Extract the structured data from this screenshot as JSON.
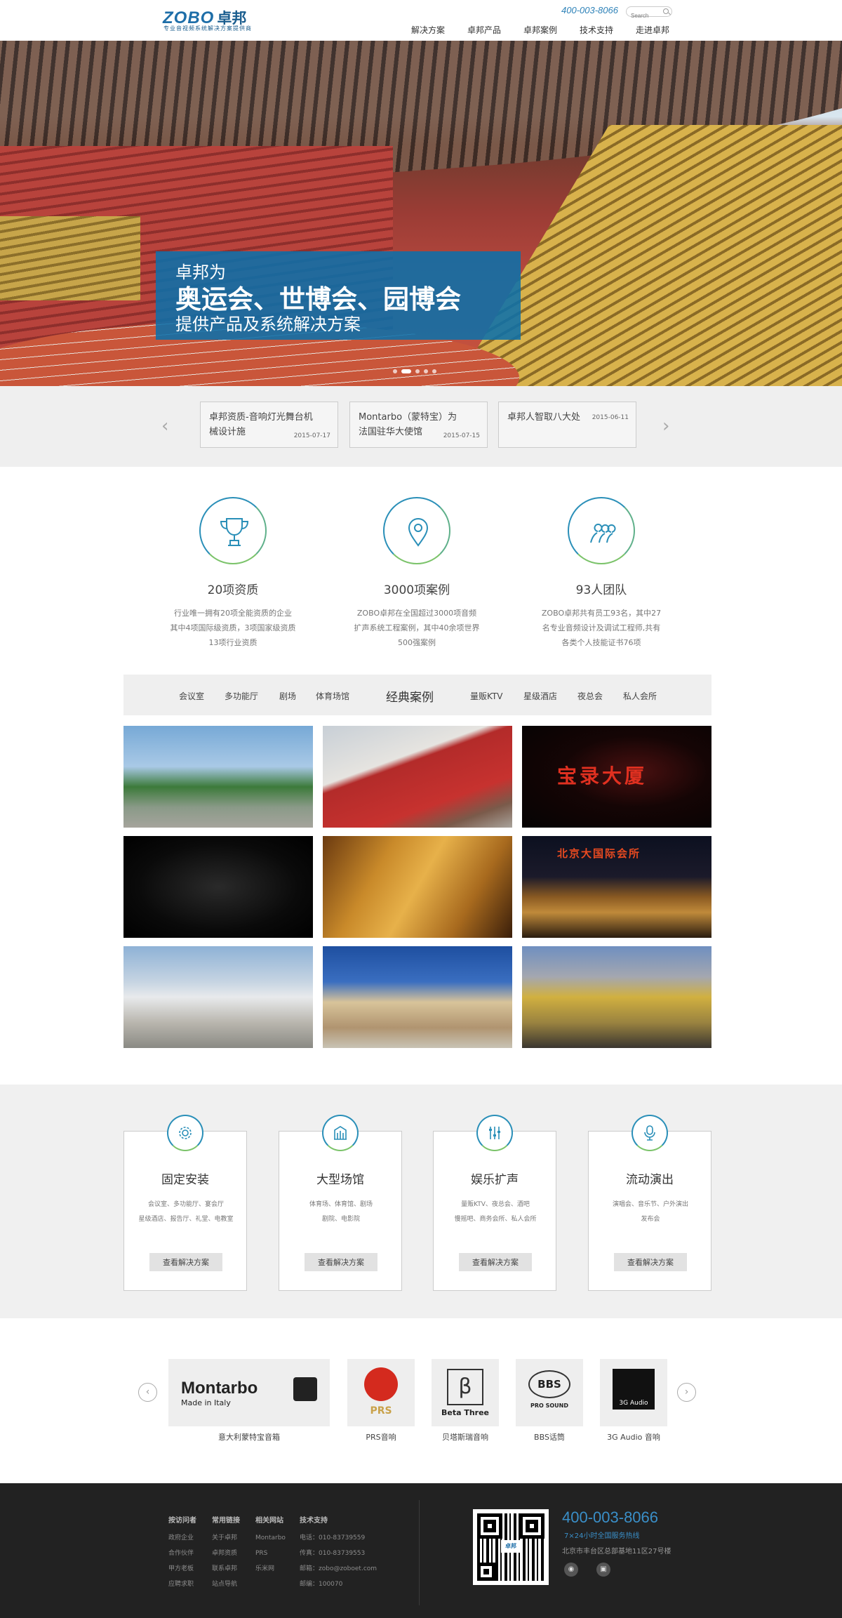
{
  "header": {
    "logo_word": "ZOBO",
    "logo_cn": "卓邦",
    "logo_sub": "专业音视频系统解决方案提供商",
    "hotline": "400-003-8066",
    "search_placeholder": "Search",
    "nav": [
      "解决方案",
      "卓邦产品",
      "卓邦案例",
      "技术支持",
      "走进卓邦"
    ]
  },
  "hero": {
    "line1": "卓邦为",
    "line2": "奥运会、世博会、园博会",
    "line3": "提供产品及系统解决方案",
    "slides": 5,
    "active_slide": 2
  },
  "news": [
    {
      "title": "卓邦资质-音响灯光舞台机械设计施",
      "date": "2015-07-17"
    },
    {
      "title": "Montarbo（蒙特宝）为法国驻华大使馆",
      "date": "2015-07-15"
    },
    {
      "title": "卓邦人智取八大处",
      "date": "2015-06-11"
    }
  ],
  "stats": [
    {
      "title": "20项资质",
      "desc": [
        "行业唯一拥有20项全能资质的企业",
        "其中4项国际级资质，3项国家级资质",
        "13项行业资质"
      ]
    },
    {
      "title": "3000项案例",
      "desc": [
        "ZOBO卓邦在全国超过3000项音频",
        "扩声系统工程案例，其中40余项世界",
        "500强案例"
      ]
    },
    {
      "title": "93人团队",
      "desc": [
        "ZOBO卓邦共有员工93名，其中27",
        "名专业音频设计及调试工程师,共有",
        "各类个人技能证书76项"
      ]
    }
  ],
  "cases": {
    "title": "经典案例",
    "left_tabs": [
      "会议室",
      "多功能厅",
      "剧场",
      "体育场馆"
    ],
    "right_tabs": [
      "量贩KTV",
      "星级酒店",
      "夜总会",
      "私人会所"
    ],
    "image_labels": {
      "c3": "宝录大厦",
      "c6": "北京大国际会所"
    }
  },
  "solutions": [
    {
      "title": "固定安装",
      "desc": [
        "会议室、多功能厅、宴会厅",
        "星级酒店、报告厅、礼堂、电教室"
      ],
      "button": "查看解决方案",
      "icon": "gear-icon"
    },
    {
      "title": "大型场馆",
      "desc": [
        "体育场、体育馆、剧场",
        "剧院、电影院"
      ],
      "button": "查看解决方案",
      "icon": "building-icon"
    },
    {
      "title": "娱乐扩声",
      "desc": [
        "量贩KTV、夜总会、酒吧",
        "慢摇吧、商务会所、私人会所"
      ],
      "button": "查看解决方案",
      "icon": "mixer-icon"
    },
    {
      "title": "流动演出",
      "desc": [
        "演唱会、音乐节、户外演出",
        "发布会"
      ],
      "button": "查看解决方案",
      "icon": "microphone-icon"
    }
  ],
  "brands": [
    {
      "name": "意大利蒙特宝音箱",
      "logo": "Montarbo",
      "logo_sub": "Made in Italy"
    },
    {
      "name": "PRS音响",
      "logo": "PRS"
    },
    {
      "name": "贝塔斯瑞音响",
      "logo": "Beta Three"
    },
    {
      "name": "BBS话筒",
      "logo": "BBS",
      "logo_sub": "PRO SOUND"
    },
    {
      "name": "3G Audio 音响",
      "logo": "3G Audio"
    }
  ],
  "footer": {
    "columns": [
      {
        "heading": "按访问者",
        "items": [
          "政府企业",
          "合作伙伴",
          "甲方老板",
          "应聘求职"
        ]
      },
      {
        "heading": "常用链接",
        "items": [
          "关于卓邦",
          "卓邦资质",
          "联系卓邦",
          "站点导航"
        ]
      },
      {
        "heading": "相关网站",
        "items": [
          "Montarbo",
          "PRS",
          "乐米网"
        ]
      },
      {
        "heading": "技术支持",
        "items": [
          "电话：010-83739559",
          "传真：010-83739553",
          "邮箱：zobo@zoboet.com",
          "邮编：100070"
        ]
      }
    ],
    "hotline": "400-003-8066",
    "hotline_sub": "7×24小时全国服务热线",
    "address": "北京市丰台区总部基地11区27号楼",
    "qr_text": "卓邦"
  },
  "colors": {
    "accent": "#0c70aa",
    "footer_bg": "#222222",
    "gray_band": "#efefef"
  }
}
